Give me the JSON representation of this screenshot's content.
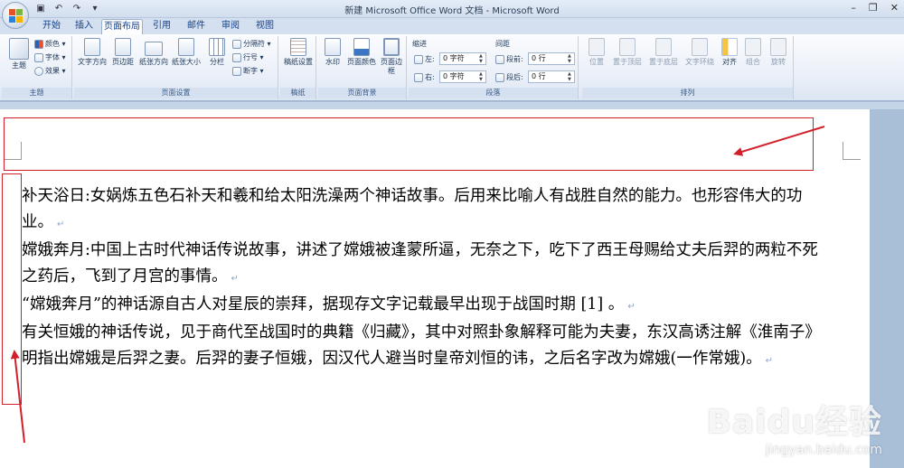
{
  "window": {
    "title": "新建 Microsoft Office Word 文档 - Microsoft Word"
  },
  "quick_access": [
    "save-icon",
    "undo-icon",
    "redo-icon",
    "customize-icon"
  ],
  "tabs": [
    "开始",
    "插入",
    "页面布局",
    "引用",
    "邮件",
    "审阅",
    "视图"
  ],
  "active_tab": "页面布局",
  "ribbon": {
    "theme_group": {
      "label": "主题",
      "theme_button": "主题",
      "colors": "颜色",
      "fonts": "字体",
      "effects": "效果"
    },
    "page_setup_group": {
      "label": "页面设置",
      "buttons": [
        "文字方向",
        "页边距",
        "纸张方向",
        "纸张大小",
        "分栏"
      ],
      "breaks": "分隔符",
      "line_numbers": "行号",
      "hyphenation": "断字"
    },
    "draft_group": {
      "label": "稿纸",
      "button": "稿纸设置"
    },
    "page_background_group": {
      "label": "页面背景",
      "buttons": [
        "水印",
        "页面颜色",
        "页面边框"
      ]
    },
    "paragraph_group": {
      "label": "段落",
      "indent_title": "缩进",
      "spacing_title": "间距",
      "left_label": "左:",
      "left_value": "0 字符",
      "right_label": "右:",
      "right_value": "0 字符",
      "before_label": "段前:",
      "before_value": "0 行",
      "after_label": "段后:",
      "after_value": "0 行"
    },
    "arrange_group": {
      "label": "排列",
      "buttons": [
        "位置",
        "置于顶层",
        "置于底层",
        "文字环绕",
        "对齐",
        "组合",
        "旋转"
      ]
    }
  },
  "document": {
    "paragraphs": [
      "补天浴日:女娲炼五色石补天和羲和给太阳洗澡两个神话故事。后用来比喻人有战胜自然的能力。也形容伟大的功业。",
      "嫦娥奔月:中国上古时代神话传说故事，讲述了嫦娥被逢蒙所逼，无奈之下，吃下了西王母赐给丈夫后羿的两粒不死之药后，飞到了月宫的事情。",
      "“嫦娥奔月”的神话源自古人对星辰的崇拜，据现存文字记载最早出现于战国时期  [1]    。",
      "有关恒娥的神话传说，见于商代至战国时的典籍《归藏》，其中对照卦象解释可能为夫妻，东汉高诱注解《淮南子》明指出嫦娥是后羿之妻。后羿的妻子恒娥，因汉代人避当时皇帝刘恒的讳，之后名字改为嫦娥(一作常娥)。"
    ],
    "paragraph_mark": "↵"
  },
  "watermark": {
    "main": "Baidu经验",
    "sub": "jingyan.baidu.com"
  },
  "colors": {
    "annotation": "#d31f2a",
    "ribbon_text": "#15428b"
  }
}
